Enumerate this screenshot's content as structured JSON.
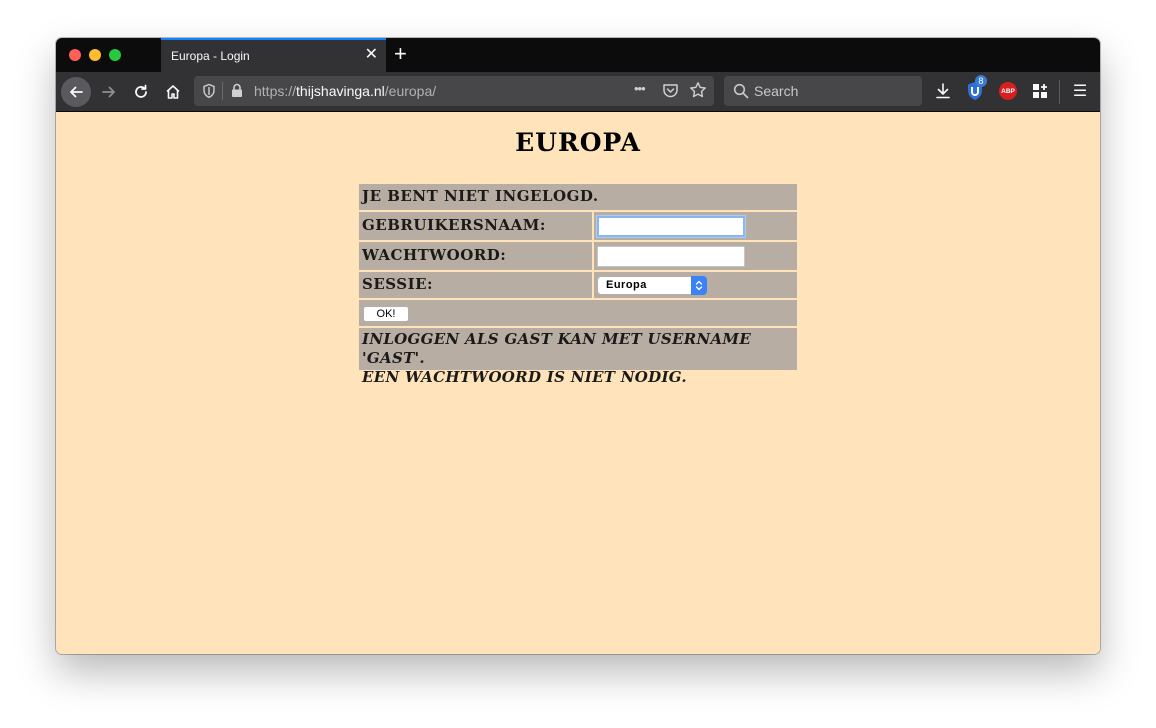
{
  "browser": {
    "tab_title": "Europa - Login",
    "tab_close_glyph": "✕",
    "new_tab_glyph": "+",
    "url_prefix": "https://",
    "url_domain": "thijshavinga.nl",
    "url_path": "/europa/",
    "page_actions_glyph": "•••",
    "search_placeholder": "Search",
    "extension_badge": "8",
    "abp_label": "ABP",
    "menu_glyph": "☰"
  },
  "page": {
    "title": "EUROPA",
    "status": "JE BENT NIET INGELOGD.",
    "username_label": "GEBRUIKERSNAAM:",
    "username_value": "",
    "password_label": "WACHTWOORD:",
    "password_value": "",
    "session_label": "SESSIE:",
    "session_selected": "Europa",
    "ok_button": "OK!",
    "note_line1": "INLOGGEN ALS GAST KAN MET USERNAME 'GAST'.",
    "note_line2": "EEN WACHTWOORD IS NIET NODIG."
  },
  "colors": {
    "page_background": "#ffe4bb",
    "table_cell": "#b8ada2",
    "browser_chrome": "#323234",
    "focus_ring": "#8ab6f0",
    "select_accent": "#3a82f6"
  }
}
